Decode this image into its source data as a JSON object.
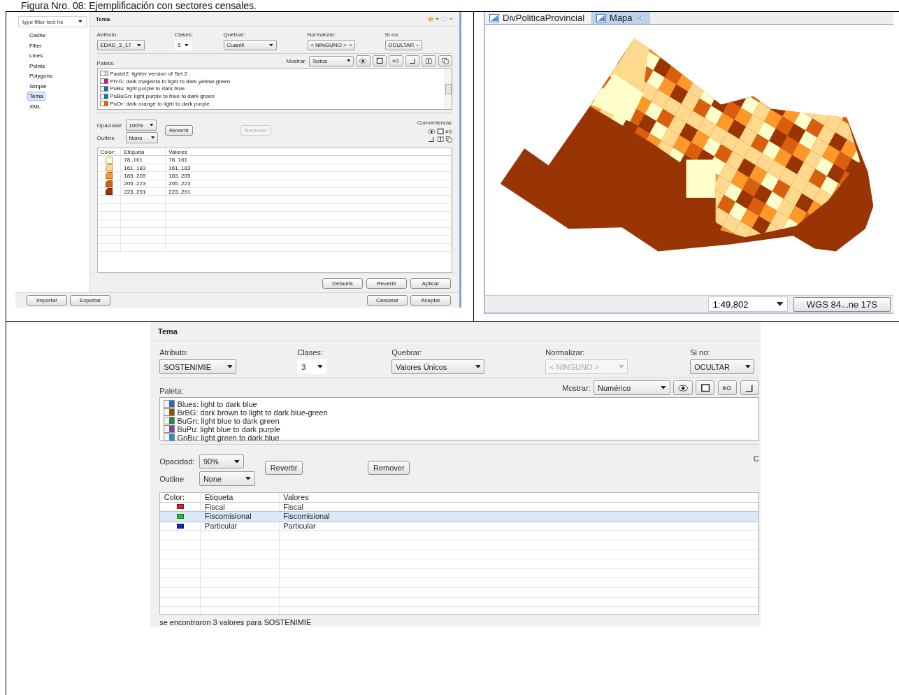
{
  "caption": "Figura Nro. 08: Ejemplificación con sectores censales.",
  "preferences": {
    "filter": {
      "placeholder": "type filter text he"
    },
    "tree": [
      {
        "label": "Cache",
        "selected": false
      },
      {
        "label": "Filter",
        "selected": false
      },
      {
        "label": "Lines",
        "selected": false
      },
      {
        "label": "Points",
        "selected": false
      },
      {
        "label": "Polygons",
        "selected": false
      },
      {
        "label": "Simple",
        "selected": false
      },
      {
        "label": "Tema",
        "selected": true
      },
      {
        "label": "XML",
        "selected": false
      }
    ],
    "panel": {
      "title": "Tema",
      "fields": [
        {
          "label": "Atributo:",
          "value": "EDAD_3_17",
          "kind": "combo",
          "disabled": false
        },
        {
          "label": "Clases:",
          "value": "5",
          "kind": "spinner",
          "disabled": false
        },
        {
          "label": "Quebrar:",
          "value": "Cuantil",
          "kind": "combo",
          "disabled": false
        },
        {
          "label": "Normalizar:",
          "value": "< NINGUNO >",
          "kind": "combo",
          "disabled": false
        },
        {
          "label": "Si no:",
          "value": "OCULTAR",
          "kind": "combo",
          "disabled": false
        }
      ],
      "show": {
        "label": "Mostrar:",
        "value": "Todos"
      },
      "palette": {
        "label": "Paleta:",
        "items": [
          {
            "label": "Pastel2: lighter version of Set 2",
            "color": "#cbd5e8"
          },
          {
            "label": "PiYG: dark magenta to light to dark yellow-green",
            "color": "#c51b7d"
          },
          {
            "label": "PuBu: light purple to dark blue",
            "color": "#0570b0"
          },
          {
            "label": "PuBuGn: light purple to blue to dark green",
            "color": "#02818a"
          },
          {
            "label": "PuOr: dark orange to light to dark purple",
            "color": "#e66101"
          }
        ]
      },
      "opacity": {
        "label": "Opacidad:",
        "value": "100%"
      },
      "outline": {
        "label": "Outline",
        "value": "None"
      },
      "buttons": [
        {
          "label": "Revertir",
          "disabled": false
        },
        {
          "label": "Remover",
          "disabled": true
        }
      ],
      "convenience": "Conveniencia:",
      "legend": {
        "columns": [
          "Color:",
          "Etiqueta",
          "Valores"
        ],
        "rows": [
          {
            "color": "#ffffcc",
            "label": "78..161",
            "value": "78..161",
            "selected": false
          },
          {
            "color": "#fed98e",
            "label": "161..183",
            "value": "161..183",
            "selected": false
          },
          {
            "color": "#fe9929",
            "label": "183..205",
            "value": "183..205",
            "selected": false
          },
          {
            "color": "#d95f0e",
            "label": "205..223",
            "value": "205..223",
            "selected": false
          },
          {
            "color": "#993404",
            "label": "223..291",
            "value": "223..291",
            "selected": false
          }
        ]
      }
    },
    "panel_buttons": [
      "Defaults",
      "Revertir",
      "Aplicar"
    ],
    "footer_left_buttons": [
      "Importar",
      "Exportar"
    ],
    "footer_right_buttons": [
      "Cancelar",
      "Aceptar"
    ]
  },
  "map_view": {
    "tabs": [
      {
        "label": "DivPoliticaProvincial",
        "selected": false,
        "closable": false
      },
      {
        "label": "Mapa",
        "selected": true,
        "closable": true
      }
    ],
    "scale": "1:49,802",
    "crs_button": "WGS 84...ne 17S"
  },
  "theme_panel": {
    "title": "Tema",
    "fields": [
      {
        "label": "Atributo:",
        "value": "SOSTENIMIE",
        "kind": "combo",
        "disabled": false
      },
      {
        "label": "Clases:",
        "value": "3",
        "kind": "spinner",
        "disabled": false
      },
      {
        "label": "Quebrar:",
        "value": "Valores Únicos",
        "kind": "combo",
        "disabled": false
      },
      {
        "label": "Normalizar:",
        "value": "< NINGUNO >",
        "kind": "combo",
        "disabled": true
      },
      {
        "label": "Si no:",
        "value": "OCULTAR",
        "kind": "combo",
        "disabled": false
      }
    ],
    "show": {
      "label": "Mostrar:",
      "value": "Numérico"
    },
    "palette": {
      "label": "Paleta:",
      "items": [
        {
          "label": "Blues: light to dark blue",
          "color": "#2171b5"
        },
        {
          "label": "BrBG: dark brown to light to dark blue-green",
          "color": "#8c510a"
        },
        {
          "label": "BuGn: light blue to dark green",
          "color": "#238b45"
        },
        {
          "label": "BuPu: light blue to dark purple",
          "color": "#88419d"
        },
        {
          "label": "GnBu: light green to dark blue",
          "color": "#2b8cbe"
        }
      ]
    },
    "opacity": {
      "label": "Opacidad:",
      "value": "90%"
    },
    "outline": {
      "label": "Outline",
      "value": "None"
    },
    "buttons": [
      {
        "label": "Revertir",
        "disabled": false
      },
      {
        "label": "Remover",
        "disabled": false
      }
    ],
    "convenience": "C",
    "legend": {
      "columns": [
        "Color:",
        "Etiqueta",
        "Valores"
      ],
      "rows": [
        {
          "color": "#e02020",
          "label": "Fiscal",
          "value": "Fiscal",
          "selected": false
        },
        {
          "color": "#20c020",
          "label": "Fiscomisional",
          "value": "Fiscomisional",
          "selected": true
        },
        {
          "color": "#2020c0",
          "label": "Particular",
          "value": "Particular",
          "selected": false
        }
      ]
    },
    "status": "se encontraron 3 valores para SOSTENIMIE"
  }
}
